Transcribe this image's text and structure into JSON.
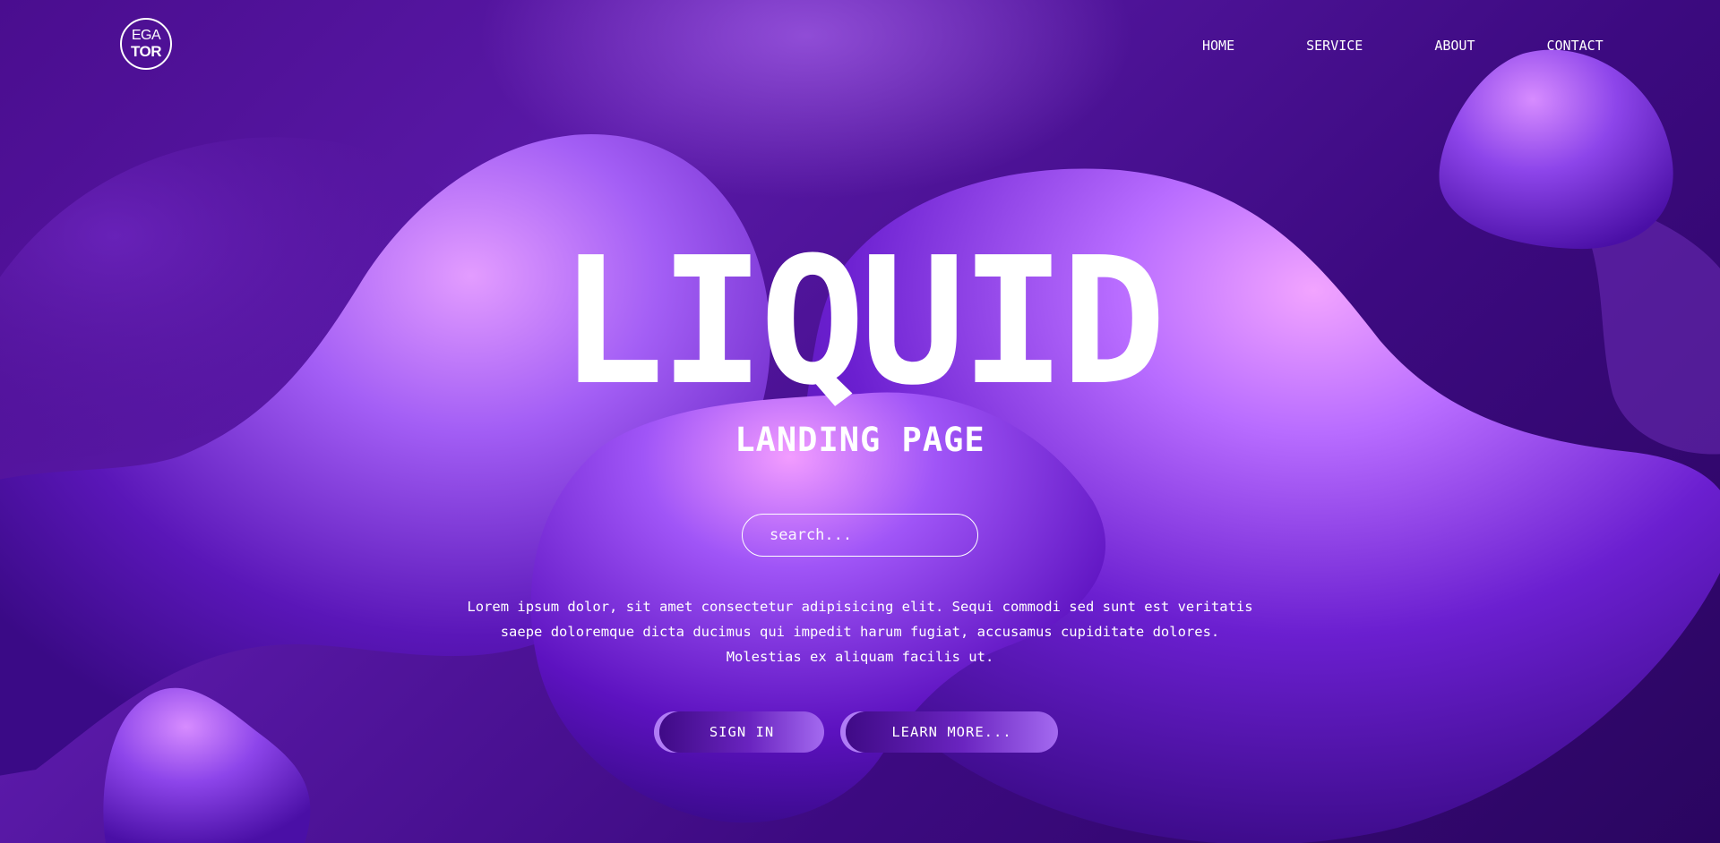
{
  "brand": {
    "logo_line1": "EGA",
    "logo_line2": "TOR"
  },
  "nav": {
    "items": [
      {
        "label": "HOME"
      },
      {
        "label": "SERVICE"
      },
      {
        "label": "ABOUT"
      },
      {
        "label": "CONTACT"
      }
    ]
  },
  "hero": {
    "title": "LIQUID",
    "subtitle": "LANDING PAGE",
    "search_placeholder": "search...",
    "description": "Lorem ipsum dolor, sit amet consectetur adipisicing elit. Sequi commodi sed sunt est veritatis saepe doloremque dicta ducimus qui impedit harum fugiat, accusamus cupiditate dolores. Molestias ex aliquam facilis ut.",
    "buttons": {
      "sign_in": "SIGN IN",
      "learn_more": "LEARN MORE..."
    }
  },
  "colors": {
    "background": "#4a0d8f",
    "blob_light": "#c48cff",
    "blob_highlight": "#f7a6ff",
    "text": "#ffffff"
  }
}
